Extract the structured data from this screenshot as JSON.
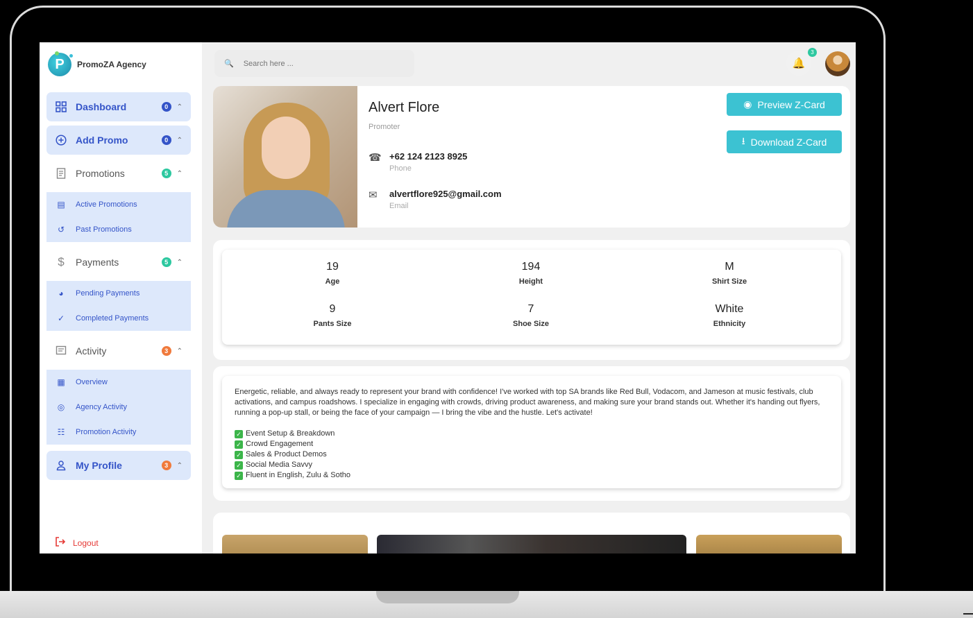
{
  "brand": {
    "name": "PromoZA Agency",
    "logo_letter": "P"
  },
  "search": {
    "placeholder": "Search here ..."
  },
  "notifications": {
    "count": "3"
  },
  "sidebar": {
    "items": [
      {
        "label": "Dashboard",
        "badge": "0",
        "badge_color": "#3454c8",
        "icon": "dashboard-icon"
      },
      {
        "label": "Add Promo",
        "badge": "0",
        "badge_color": "#3454c8",
        "icon": "add-circle-icon"
      },
      {
        "label": "Promotions",
        "badge": "5",
        "badge_color": "#2dc8a0",
        "icon": "receipt-icon",
        "children": [
          {
            "label": "Active Promotions",
            "icon": "receipt-icon"
          },
          {
            "label": "Past Promotions",
            "icon": "history-icon"
          }
        ]
      },
      {
        "label": "Payments",
        "badge": "5",
        "badge_color": "#2dc8a0",
        "icon": "dollar-icon",
        "children": [
          {
            "label": "Pending Payments",
            "icon": "clock-icon"
          },
          {
            "label": "Completed Payments",
            "icon": "check-icon"
          }
        ]
      },
      {
        "label": "Activity",
        "badge": "3",
        "badge_color": "#f07a3c",
        "icon": "chat-icon",
        "children": [
          {
            "label": "Overview",
            "icon": "calendar-icon"
          },
          {
            "label": "Agency Activity",
            "icon": "target-icon"
          },
          {
            "label": "Promotion Activity",
            "icon": "network-icon"
          }
        ]
      },
      {
        "label": "My Profile",
        "badge": "3",
        "badge_color": "#f07a3c",
        "icon": "user-icon"
      }
    ],
    "logout": "Logout"
  },
  "profile": {
    "name": "Alvert Flore",
    "role": "Promoter",
    "phone": "+62 124 2123 8925",
    "phone_label": "Phone",
    "email": "alvertflore925@gmail.com",
    "email_label": "Email",
    "preview_button": "Preview Z-Card",
    "download_button": "Download Z-Card"
  },
  "stats": [
    {
      "value": "19",
      "label": "Age"
    },
    {
      "value": "194",
      "label": "Height"
    },
    {
      "value": "M",
      "label": "Shirt Size"
    },
    {
      "value": "9",
      "label": "Pants Size"
    },
    {
      "value": "7",
      "label": "Shoe Size"
    },
    {
      "value": "White",
      "label": "Ethnicity"
    }
  ],
  "bio": {
    "text": "Energetic, reliable, and always ready to represent your brand with confidence! I've worked with top SA brands like Red Bull, Vodacom, and Jameson at music festivals, club activations, and campus roadshows. I specialize in engaging with crowds, driving product awareness, and making sure your brand stands out. Whether it's handing out flyers, running a pop-up stall, or being the face of your campaign — I bring the vibe and the hustle. Let's activate!",
    "skills": [
      "Event Setup & Breakdown",
      "Crowd Engagement",
      "Sales & Product Demos",
      "Social Media Savvy",
      "Fluent in English, Zulu & Sotho"
    ]
  }
}
